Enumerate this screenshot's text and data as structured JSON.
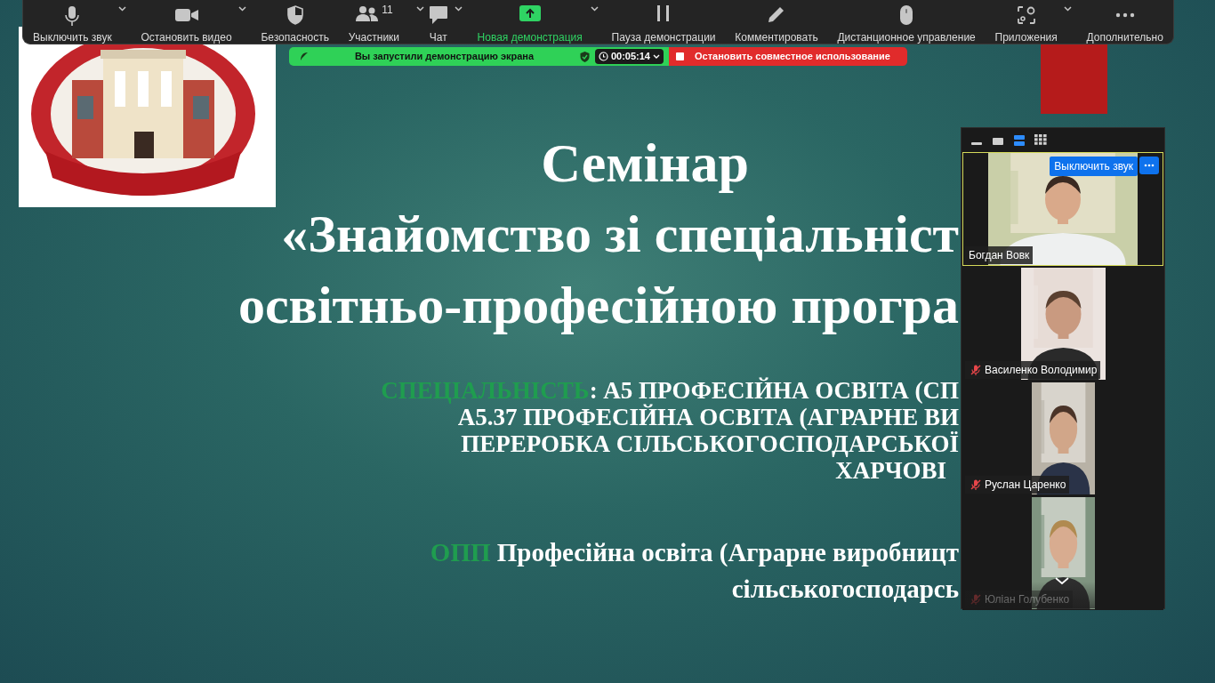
{
  "toolbar": {
    "items": [
      {
        "label": "Выключить звук",
        "kind": "mic",
        "caret": true,
        "accent": false
      },
      {
        "label": "Остановить видео",
        "kind": "camera",
        "caret": true,
        "accent": false
      },
      {
        "label": "Безопасность",
        "kind": "shield",
        "caret": false,
        "accent": false
      },
      {
        "label": "Участники",
        "kind": "people",
        "count": "11",
        "caret": true,
        "accent": false
      },
      {
        "label": "Чат",
        "kind": "chat",
        "caret": true,
        "accent": false
      },
      {
        "label": "Новая демонстрация",
        "kind": "share",
        "caret": true,
        "accent": true
      },
      {
        "label": "Пауза демонстрации",
        "kind": "pause",
        "caret": false,
        "accent": false
      },
      {
        "label": "Комментировать",
        "kind": "pen",
        "caret": false,
        "accent": false
      },
      {
        "label": "Дистанционное управление",
        "kind": "mouse",
        "caret": false,
        "accent": false
      },
      {
        "label": "Приложения",
        "kind": "apps",
        "caret": true,
        "accent": false
      },
      {
        "label": "Дополнительно",
        "kind": "more",
        "caret": false,
        "accent": false
      }
    ]
  },
  "share_bar": {
    "status": "Вы запустили демонстрацию экрана",
    "timer": "00:05:14",
    "stop_label": "Остановить совместное использование"
  },
  "slide": {
    "lines": [
      {
        "kind": "title",
        "text": "Семінар"
      },
      {
        "kind": "heading",
        "text": "«Знайомство зі спеціальніст"
      },
      {
        "kind": "heading",
        "text": "освітньо-професійною програ"
      },
      {
        "kind": "spec",
        "highlight": "СПЕЦІАЛЬНІСТЬ",
        "text": ": А5 ПРОФЕСІЙНА ОСВІТА (СП"
      },
      {
        "kind": "spec",
        "text": "А5.37 ПРОФЕСІЙНА ОСВІТА (АГРАРНЕ ВИ"
      },
      {
        "kind": "spec",
        "text": "ПЕРЕРОБКА СІЛЬСЬКОГОСПОДАРСЬКОЇ"
      },
      {
        "kind": "spec",
        "text": "ХАРЧОВІ"
      },
      {
        "kind": "program",
        "highlight": "ОПП",
        "text": " Професійна освіта (Аграрне виробницт"
      },
      {
        "kind": "program",
        "text": "сільськогосподарсь"
      }
    ]
  },
  "video_panel": {
    "views": [
      {
        "kind": "minimize",
        "selected": false
      },
      {
        "kind": "speaker",
        "selected": false
      },
      {
        "kind": "strip",
        "selected": true
      },
      {
        "kind": "gallery",
        "selected": false
      }
    ],
    "tiles": [
      {
        "name": "Богдан Вовк",
        "muted": false,
        "active": true,
        "mute_button": "Выключить звук"
      },
      {
        "name": "Василенко Володимир",
        "muted": true,
        "active": false
      },
      {
        "name": "Руслан Царенко",
        "muted": true,
        "active": false
      },
      {
        "name": "Юліан Голубенко",
        "muted": true,
        "active": false
      }
    ]
  }
}
